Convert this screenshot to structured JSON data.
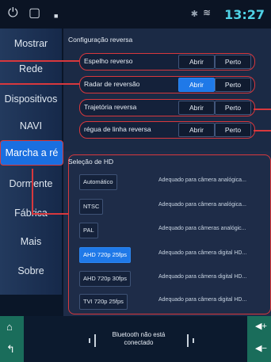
{
  "statusbar": {
    "power_icon": "power-icon",
    "window_icon": "window-icon",
    "media_icon": "media-icon",
    "bluetooth_icon": "bluetooth-icon",
    "wifi_icon": "wifi-icon",
    "time": "13:27"
  },
  "sidebar": {
    "items": [
      {
        "label": "Mostrar"
      },
      {
        "label": "Rede"
      },
      {
        "label": "Dispositivos"
      },
      {
        "label": "NAVI"
      },
      {
        "label": "Marcha a ré"
      },
      {
        "label": "Dormente"
      },
      {
        "label": "Fábrica"
      },
      {
        "label": "Mais"
      },
      {
        "label": "Sobre"
      }
    ]
  },
  "reverse": {
    "title": "Configuração reversa",
    "rows": [
      {
        "label": "Espelho reverso",
        "open": "Abrir",
        "close": "Perto",
        "selected": "none"
      },
      {
        "label": "Radar de reversão",
        "open": "Abrir",
        "close": "Perto",
        "selected": "open"
      },
      {
        "label": "Trajetória reversa",
        "open": "Abrir",
        "close": "Perto",
        "selected": "none"
      },
      {
        "label": "régua de linha reversa",
        "open": "Abrir",
        "close": "Perto",
        "selected": "none"
      }
    ]
  },
  "hd": {
    "title": "Seleção de HD",
    "options": [
      {
        "label": "Automático",
        "desc": "Adequado para câmera analógica...",
        "selected": false
      },
      {
        "label": "NTSC",
        "desc": "Adequado para câmera analógica...",
        "selected": false
      },
      {
        "label": "PAL",
        "desc": "Adequado para câmeras analógic...",
        "selected": false
      },
      {
        "label": "AHD 720p 25fps",
        "desc": "Adequado para câmera digital HD...",
        "selected": true
      },
      {
        "label": "AHD 720p 30fps",
        "desc": "Adequado para câmera digital HD...",
        "selected": false
      },
      {
        "label": "TVI 720p 25fps",
        "desc": "Adequado para câmera digital HD...",
        "selected": false
      }
    ]
  },
  "bottom": {
    "bt_line1": "Bluetooth não está",
    "bt_line2": "conectado",
    "home_icon": "home-icon",
    "back_icon": "back-icon",
    "vol_up_icon": "volume-up-icon",
    "vol_down_icon": "volume-down-icon"
  },
  "colors": {
    "accent": "#1f79e8",
    "highlight": "#d8383d",
    "time": "#4fd2e6"
  }
}
